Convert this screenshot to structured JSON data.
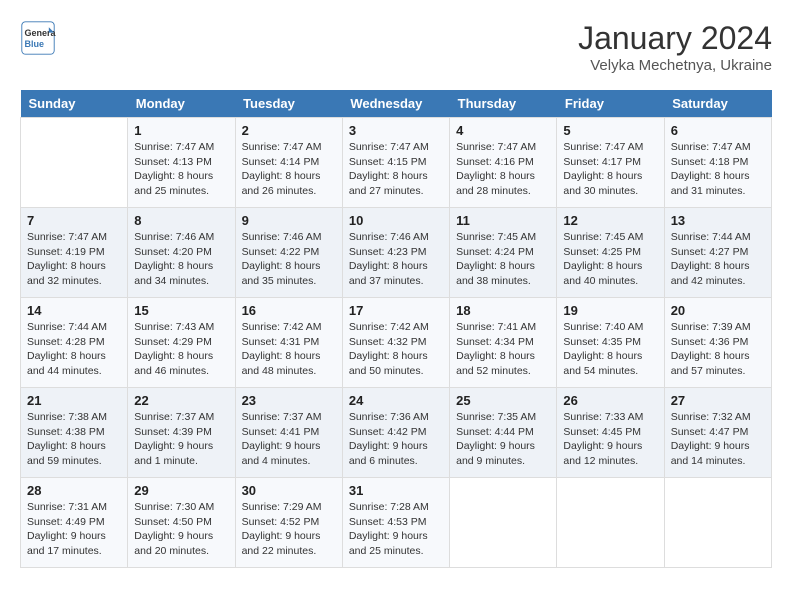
{
  "header": {
    "logo_line1": "General",
    "logo_line2": "Blue",
    "month": "January 2024",
    "location": "Velyka Mechetnya, Ukraine"
  },
  "weekdays": [
    "Sunday",
    "Monday",
    "Tuesday",
    "Wednesday",
    "Thursday",
    "Friday",
    "Saturday"
  ],
  "weeks": [
    [
      {
        "day": "",
        "info": ""
      },
      {
        "day": "1",
        "info": "Sunrise: 7:47 AM\nSunset: 4:13 PM\nDaylight: 8 hours\nand 25 minutes."
      },
      {
        "day": "2",
        "info": "Sunrise: 7:47 AM\nSunset: 4:14 PM\nDaylight: 8 hours\nand 26 minutes."
      },
      {
        "day": "3",
        "info": "Sunrise: 7:47 AM\nSunset: 4:15 PM\nDaylight: 8 hours\nand 27 minutes."
      },
      {
        "day": "4",
        "info": "Sunrise: 7:47 AM\nSunset: 4:16 PM\nDaylight: 8 hours\nand 28 minutes."
      },
      {
        "day": "5",
        "info": "Sunrise: 7:47 AM\nSunset: 4:17 PM\nDaylight: 8 hours\nand 30 minutes."
      },
      {
        "day": "6",
        "info": "Sunrise: 7:47 AM\nSunset: 4:18 PM\nDaylight: 8 hours\nand 31 minutes."
      }
    ],
    [
      {
        "day": "7",
        "info": "Sunrise: 7:47 AM\nSunset: 4:19 PM\nDaylight: 8 hours\nand 32 minutes."
      },
      {
        "day": "8",
        "info": "Sunrise: 7:46 AM\nSunset: 4:20 PM\nDaylight: 8 hours\nand 34 minutes."
      },
      {
        "day": "9",
        "info": "Sunrise: 7:46 AM\nSunset: 4:22 PM\nDaylight: 8 hours\nand 35 minutes."
      },
      {
        "day": "10",
        "info": "Sunrise: 7:46 AM\nSunset: 4:23 PM\nDaylight: 8 hours\nand 37 minutes."
      },
      {
        "day": "11",
        "info": "Sunrise: 7:45 AM\nSunset: 4:24 PM\nDaylight: 8 hours\nand 38 minutes."
      },
      {
        "day": "12",
        "info": "Sunrise: 7:45 AM\nSunset: 4:25 PM\nDaylight: 8 hours\nand 40 minutes."
      },
      {
        "day": "13",
        "info": "Sunrise: 7:44 AM\nSunset: 4:27 PM\nDaylight: 8 hours\nand 42 minutes."
      }
    ],
    [
      {
        "day": "14",
        "info": "Sunrise: 7:44 AM\nSunset: 4:28 PM\nDaylight: 8 hours\nand 44 minutes."
      },
      {
        "day": "15",
        "info": "Sunrise: 7:43 AM\nSunset: 4:29 PM\nDaylight: 8 hours\nand 46 minutes."
      },
      {
        "day": "16",
        "info": "Sunrise: 7:42 AM\nSunset: 4:31 PM\nDaylight: 8 hours\nand 48 minutes."
      },
      {
        "day": "17",
        "info": "Sunrise: 7:42 AM\nSunset: 4:32 PM\nDaylight: 8 hours\nand 50 minutes."
      },
      {
        "day": "18",
        "info": "Sunrise: 7:41 AM\nSunset: 4:34 PM\nDaylight: 8 hours\nand 52 minutes."
      },
      {
        "day": "19",
        "info": "Sunrise: 7:40 AM\nSunset: 4:35 PM\nDaylight: 8 hours\nand 54 minutes."
      },
      {
        "day": "20",
        "info": "Sunrise: 7:39 AM\nSunset: 4:36 PM\nDaylight: 8 hours\nand 57 minutes."
      }
    ],
    [
      {
        "day": "21",
        "info": "Sunrise: 7:38 AM\nSunset: 4:38 PM\nDaylight: 8 hours\nand 59 minutes."
      },
      {
        "day": "22",
        "info": "Sunrise: 7:37 AM\nSunset: 4:39 PM\nDaylight: 9 hours\nand 1 minute."
      },
      {
        "day": "23",
        "info": "Sunrise: 7:37 AM\nSunset: 4:41 PM\nDaylight: 9 hours\nand 4 minutes."
      },
      {
        "day": "24",
        "info": "Sunrise: 7:36 AM\nSunset: 4:42 PM\nDaylight: 9 hours\nand 6 minutes."
      },
      {
        "day": "25",
        "info": "Sunrise: 7:35 AM\nSunset: 4:44 PM\nDaylight: 9 hours\nand 9 minutes."
      },
      {
        "day": "26",
        "info": "Sunrise: 7:33 AM\nSunset: 4:45 PM\nDaylight: 9 hours\nand 12 minutes."
      },
      {
        "day": "27",
        "info": "Sunrise: 7:32 AM\nSunset: 4:47 PM\nDaylight: 9 hours\nand 14 minutes."
      }
    ],
    [
      {
        "day": "28",
        "info": "Sunrise: 7:31 AM\nSunset: 4:49 PM\nDaylight: 9 hours\nand 17 minutes."
      },
      {
        "day": "29",
        "info": "Sunrise: 7:30 AM\nSunset: 4:50 PM\nDaylight: 9 hours\nand 20 minutes."
      },
      {
        "day": "30",
        "info": "Sunrise: 7:29 AM\nSunset: 4:52 PM\nDaylight: 9 hours\nand 22 minutes."
      },
      {
        "day": "31",
        "info": "Sunrise: 7:28 AM\nSunset: 4:53 PM\nDaylight: 9 hours\nand 25 minutes."
      },
      {
        "day": "",
        "info": ""
      },
      {
        "day": "",
        "info": ""
      },
      {
        "day": "",
        "info": ""
      }
    ]
  ]
}
